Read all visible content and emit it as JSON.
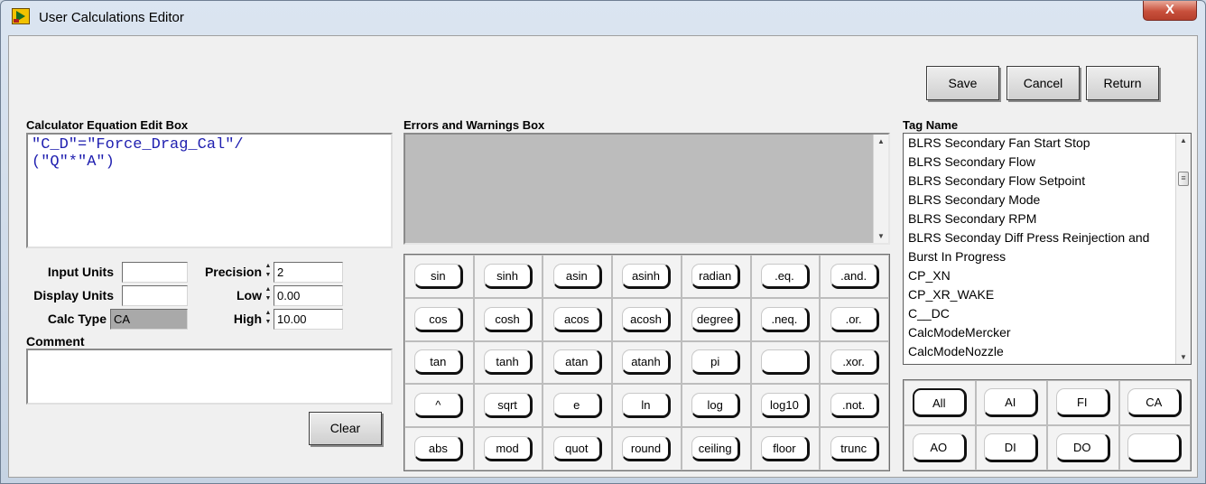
{
  "window": {
    "title": "User Calculations Editor",
    "close_symbol": "X"
  },
  "toolbar": {
    "save_label": "Save",
    "cancel_label": "Cancel",
    "return_label": "Return"
  },
  "equation_box": {
    "label": "Calculator Equation Edit Box",
    "value": "\"C_D\"=\"Force_Drag_Cal\"/\n(\"Q\"*\"A\")"
  },
  "errors_box": {
    "label": "Errors and Warnings Box",
    "value": ""
  },
  "fields": {
    "input_units": {
      "label": "Input Units",
      "value": ""
    },
    "display_units": {
      "label": "Display Units",
      "value": ""
    },
    "calc_type": {
      "label": "Calc Type",
      "value": "CA"
    },
    "precision": {
      "label": "Precision",
      "value": "2"
    },
    "low": {
      "label": "Low",
      "value": "0.00"
    },
    "high": {
      "label": "High",
      "value": "10.00"
    },
    "comment": {
      "label": "Comment",
      "value": ""
    }
  },
  "clear_label": "Clear",
  "functions": [
    [
      "sin",
      "sinh",
      "asin",
      "asinh",
      "radian",
      ".eq.",
      ".and."
    ],
    [
      "cos",
      "cosh",
      "acos",
      "acosh",
      "degree",
      ".neq.",
      ".or."
    ],
    [
      "tan",
      "tanh",
      "atan",
      "atanh",
      "pi",
      "",
      ".xor."
    ],
    [
      "^",
      "sqrt",
      "e",
      "ln",
      "log",
      "log10",
      ".not."
    ],
    [
      "abs",
      "mod",
      "quot",
      "round",
      "ceiling",
      "floor",
      "trunc"
    ]
  ],
  "tag_list": {
    "label": "Tag Name",
    "items": [
      "BLRS Secondary Fan Start Stop",
      "BLRS Secondary Flow",
      "BLRS Secondary Flow Setpoint",
      "BLRS Secondary Mode",
      "BLRS Secondary RPM",
      "BLRS Seconday Diff Press Reinjection and",
      "Burst In Progress",
      "CP_XN",
      "CP_XR_WAKE",
      "C__DC",
      "CalcModeMercker",
      "CalcModeNozzle"
    ]
  },
  "filters": {
    "selected": "All",
    "rows": [
      [
        "All",
        "AI",
        "FI",
        "CA"
      ],
      [
        "AO",
        "DI",
        "DO",
        ""
      ]
    ]
  },
  "colors": {
    "equation_text": "#2020b0",
    "errors_background": "#bcbcbc",
    "calc_type_background": "#a9a9a9"
  }
}
